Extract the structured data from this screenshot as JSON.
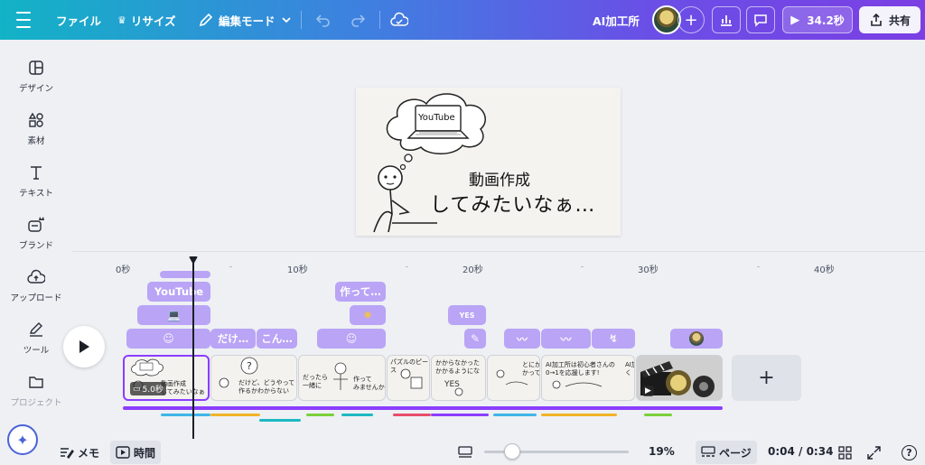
{
  "topbar": {
    "file_label": "ファイル",
    "resize_label": "リサイズ",
    "edit_mode_label": "編集モード",
    "project_name": "AI加工所",
    "play_duration": "34.2秒",
    "share_label": "共有"
  },
  "sidebar": {
    "items": [
      {
        "label": "デザイン",
        "icon": "layout-icon"
      },
      {
        "label": "素材",
        "icon": "shapes-icon"
      },
      {
        "label": "テキスト",
        "icon": "text-icon"
      },
      {
        "label": "ブランド",
        "icon": "brand-icon"
      },
      {
        "label": "アップロード",
        "icon": "upload-icon"
      },
      {
        "label": "ツール",
        "icon": "draw-icon"
      },
      {
        "label": "プロジェクト",
        "icon": "folder-icon"
      }
    ]
  },
  "canvas": {
    "laptop_text": "YouTube",
    "line1": "動画作成",
    "line2": "してみたいなぁ…"
  },
  "ruler": {
    "labels": [
      "0秒",
      "10秒",
      "20秒",
      "30秒",
      "40秒"
    ]
  },
  "tracks": {
    "youtube_chip": "YouTube",
    "tsukutte_chip": "作って…",
    "dake_chip": "だけ…",
    "kon_chip": "こん…",
    "yes_chip": "YES"
  },
  "clips": {
    "c1_text": "動画作成\nしてみたいなぁ",
    "c1_duration": "5.0秒",
    "c2_text": "だけど、どうやって\n作るかわからない",
    "c3_text_a": "だったら\n一緒に",
    "c3_text_b": "作って\nみませんか?",
    "c4_text": "パズルのピース",
    "c5_text": "かからなかった\nかかるようにな",
    "c6_text": "とにか\nかって",
    "c7_text": "AI加工所は初心者さんの\n0→1を応援します!",
    "c7b_text": "AI加\nく"
  },
  "bottombar": {
    "memo_label": "メモ",
    "time_label": "時間",
    "zoom": "19%",
    "page_label": "ページ",
    "timecode": "0:04 / 0:34",
    "help_label": "?"
  },
  "colors": {
    "accent": "#8b3dff",
    "chip": "#b9a4f5",
    "gradient_start": "#12b3c6",
    "gradient_end": "#7b3fe4"
  }
}
